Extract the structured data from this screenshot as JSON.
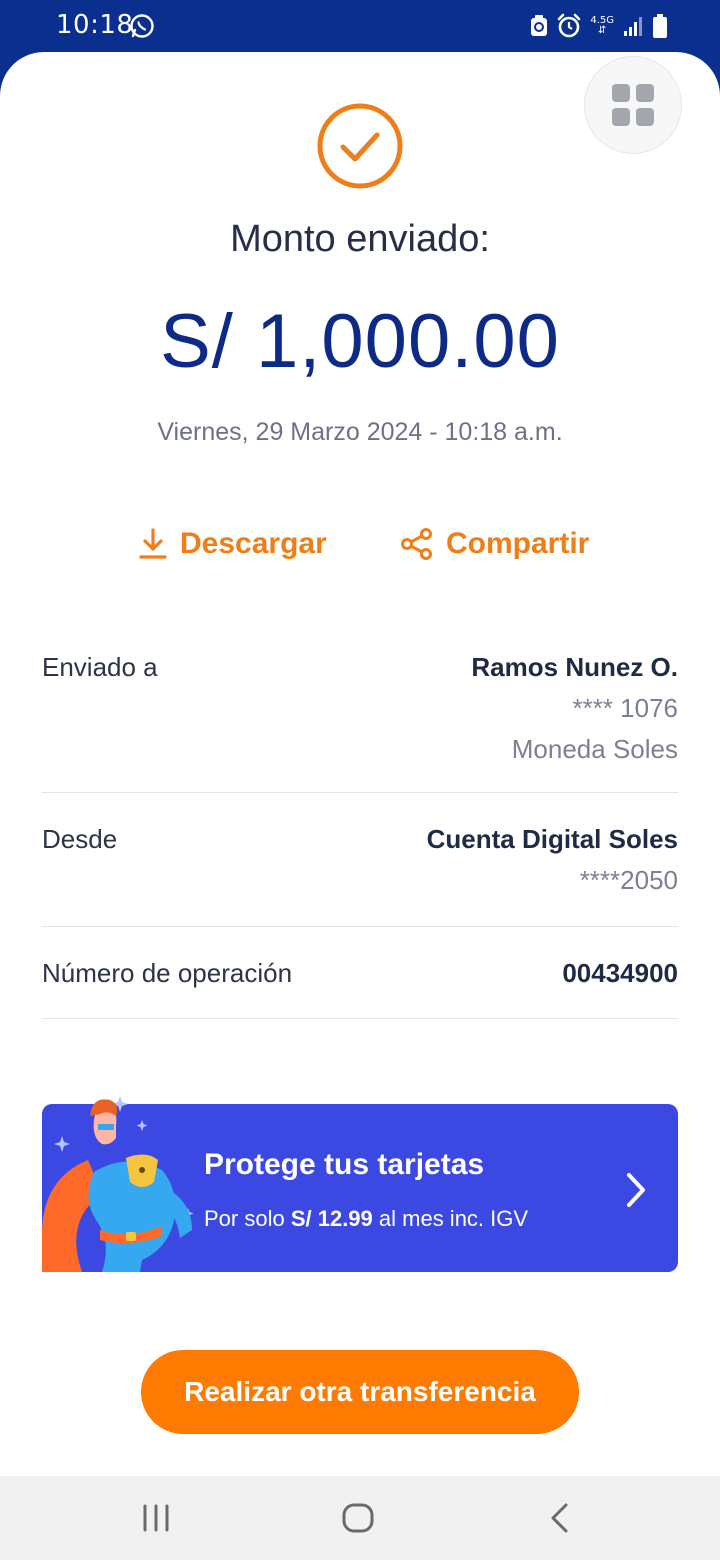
{
  "status_bar": {
    "time": "10:18",
    "network": "4.5G",
    "icons": [
      "whatsapp-icon",
      "sync-icon",
      "alarm-icon",
      "signal-icon",
      "battery-icon"
    ]
  },
  "header": {
    "grid_icon": "grid-icon"
  },
  "confirmation": {
    "title": "Monto enviado:",
    "amount": "S/ 1,000.00",
    "date": "Viernes, 29 Marzo 2024 - 10:18 a.m."
  },
  "actions": {
    "download": "Descargar",
    "share": "Compartir"
  },
  "details": {
    "sent_to": {
      "label": "Enviado a",
      "name": "Ramos Nunez O.",
      "account": "**** 1076",
      "currency": "Moneda Soles"
    },
    "from": {
      "label": "Desde",
      "account_name": "Cuenta Digital Soles",
      "account": "****2050"
    },
    "operation": {
      "label": "Número de operación",
      "number": "00434900"
    }
  },
  "promo": {
    "title": "Protege tus tarjetas",
    "sub_prefix": "Por solo ",
    "price": "S/ 12.99",
    "sub_suffix": " al mes inc. IGV"
  },
  "cta": {
    "label": "Realizar otra transferencia"
  },
  "colors": {
    "brand_blue": "#0b2f8f",
    "accent_orange": "#f07e18",
    "promo_bg": "#3c48e2"
  }
}
